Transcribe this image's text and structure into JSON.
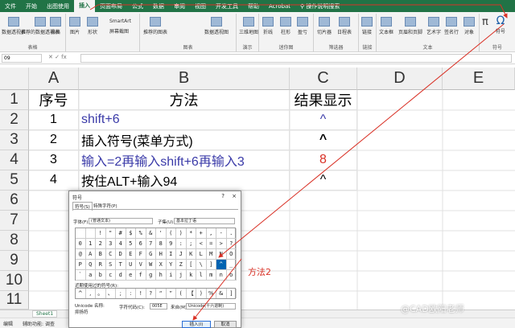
{
  "ribbon_tabs": [
    "文件",
    "开始",
    "出图使用",
    "插入",
    "页面布局",
    "公式",
    "数据",
    "审阅",
    "视图",
    "开发工具",
    "帮助",
    "Acrobat",
    "操作说明搜索"
  ],
  "ribbon_groups": {
    "tables": {
      "label": "表格",
      "buttons": [
        "数据透视表",
        "推荐的数据透视表",
        "表格"
      ]
    },
    "illustrations": {
      "buttons": [
        "图片",
        "形状",
        "SmartArt",
        "屏幕截图"
      ]
    },
    "charts": {
      "label": "图表",
      "buttons": [
        "推荐的图表",
        "数据透视图"
      ]
    },
    "tours": {
      "label": "演示",
      "buttons": [
        "三维地图"
      ]
    },
    "sparklines": {
      "label": "迷你图",
      "buttons": [
        "折线",
        "柱形",
        "盈亏"
      ]
    },
    "filters": {
      "label": "筛选器",
      "buttons": [
        "切片器",
        "日程表"
      ]
    },
    "links": {
      "label": "链接",
      "buttons": [
        "链接"
      ]
    },
    "text": {
      "label": "文本",
      "buttons": [
        "文本框",
        "页眉和页脚",
        "艺术字",
        "签名行",
        "对象"
      ]
    },
    "symbols": {
      "label": "符号",
      "buttons": [
        "公式",
        "符号"
      ]
    }
  },
  "name_box": "09",
  "columns": [
    "A",
    "B",
    "C",
    "D",
    "E"
  ],
  "rows": [
    {
      "num": "1",
      "a": "序号",
      "b": "方法",
      "c": "结果显示"
    },
    {
      "num": "2",
      "a": "1",
      "b": "shift+6",
      "c": "^"
    },
    {
      "num": "3",
      "a": "2",
      "b": "插入符号(菜单方式)",
      "c": "^"
    },
    {
      "num": "4",
      "a": "3",
      "b": "输入=2再输入shift+6再输入3",
      "c": "8"
    },
    {
      "num": "5",
      "a": "4",
      "b": "按住ALT+输入94",
      "c": "^"
    },
    {
      "num": "6"
    },
    {
      "num": "7"
    },
    {
      "num": "8"
    },
    {
      "num": "9"
    },
    {
      "num": "10"
    },
    {
      "num": "11"
    }
  ],
  "sheet_tab": "Sheet1",
  "status": {
    "mode": "编辑",
    "accessibility": "辅助功能: 调查"
  },
  "dialog": {
    "title": "符号",
    "help": "?",
    "close": "×",
    "tabs": [
      "符号(S)",
      "特殊字符(P)"
    ],
    "font_label": "字体(F):",
    "font_value": "(普通文本)",
    "subset_label": "子集(U):",
    "subset_value": "基本拉丁语",
    "symbols": [
      [
        "",
        " ",
        "!",
        "\"",
        "#",
        "$",
        "%",
        "&",
        "'",
        "(",
        ")",
        "*",
        "+",
        ",",
        "-",
        ".",
        "/"
      ],
      [
        "0",
        "1",
        "2",
        "3",
        "4",
        "5",
        "6",
        "7",
        "8",
        "9",
        ":",
        ";",
        "<",
        "=",
        ">",
        "?"
      ],
      [
        "@",
        "A",
        "B",
        "C",
        "D",
        "E",
        "F",
        "G",
        "H",
        "I",
        "J",
        "K",
        "L",
        "M",
        "N",
        "O"
      ],
      [
        "P",
        "Q",
        "R",
        "S",
        "T",
        "U",
        "V",
        "W",
        "X",
        "Y",
        "Z",
        "[",
        "\\",
        "]",
        "^",
        "_"
      ],
      [
        "`",
        "a",
        "b",
        "c",
        "d",
        "e",
        "f",
        "g",
        "h",
        "i",
        "j",
        "k",
        "l",
        "m",
        "n",
        "o"
      ]
    ],
    "selected_symbol": "^",
    "recent_label": "近期使用过的符号(R):",
    "recent_symbols": [
      "^",
      ",",
      "。",
      "、",
      ";",
      ":",
      "!",
      "?",
      "“",
      "”",
      "(",
      "【",
      ")",
      "%",
      "&",
      "]"
    ],
    "unicode_name_label": "Unicode 名称:",
    "unicode_name_value": "抑扬符",
    "char_code_label": "字符代码(C):",
    "char_code_value": "005E",
    "from_label": "来自(M):",
    "from_value": "Unicode(十六进制)",
    "insert_button": "插入(I)",
    "cancel_button": "取消"
  },
  "annotation": "方法2",
  "watermark": "@CAD欧阳老师",
  "colors": {
    "excel_green": "#217346",
    "blue_text": "#3a3aa8",
    "red_text": "#d93025",
    "black_text": "#000000"
  }
}
